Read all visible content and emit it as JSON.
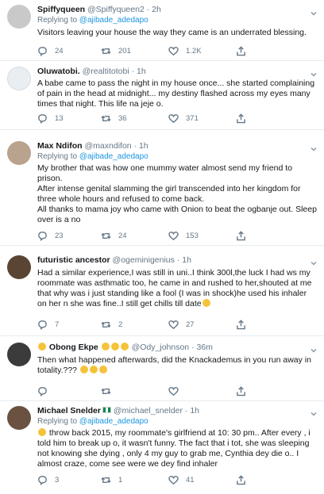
{
  "tweets": [
    {
      "name": "Spiffyqueen",
      "handle": "@Spiffyqueen2",
      "time": "2h",
      "reply_prefix": "Replying to ",
      "reply_to": "@ajibade_adedapo",
      "paragraphs": [
        "Visitors leaving your house the way they came is an underrated blessing."
      ],
      "replies": "24",
      "retweets": "201",
      "likes": "1.2K",
      "avatar_color": "#c9c9c9"
    },
    {
      "name": "Oluwatobi.",
      "handle": "@realtitotobi",
      "time": "1h",
      "paragraphs": [
        "A babe came to pass the night in my house once... she started complaining of pain in the head at midnight... my destiny flashed across my eyes many times that night. This life na jeje o."
      ],
      "replies": "13",
      "retweets": "36",
      "likes": "371",
      "avatar_color": "#e8eef2"
    },
    {
      "name": "Max Ndifon",
      "handle": "@maxndifon",
      "time": "1h",
      "reply_prefix": "Replying to ",
      "reply_to": "@ajibade_adedapo",
      "paragraphs": [
        "My brother that was how one mummy water almost send my friend to prison.",
        "After intense genital slamming the girl transcended into her kingdom for three whole hours and refused to come back.",
        "All thanks to mama joy who came with Onion to beat the ogbanje out. Sleep over is a no"
      ],
      "replies": "23",
      "retweets": "24",
      "likes": "153",
      "avatar_color": "#b9a38e"
    },
    {
      "name": "futuristic ancestor",
      "handle": "@ogeminigenius",
      "time": "1h",
      "paragraphs": [
        "Had a similar experience,I was still in uni..I think 300l,the luck I had ws my roommate was asthmatic too, he came in and rushed to her,shouted at me that why was i just standing like a fool (I was in shock)he used his inhaler on her n she was fine..I still get chills till date"
      ],
      "replies": "7",
      "retweets": "2",
      "likes": "27",
      "avatar_color": "#5a4433"
    },
    {
      "name": "Obong Ekpe",
      "handle": "@Ody_johnson",
      "time": "36m",
      "paragraphs": [
        "Then what happened afterwards, did the Knackademus in you run away in totality.???"
      ],
      "replies": "",
      "retweets": "",
      "likes": "",
      "avatar_color": "#3b3b3b"
    },
    {
      "name": "Michael Snelder",
      "handle": "@michael_snelder",
      "time": "1h",
      "reply_prefix": "Replying to ",
      "reply_to": "@ajibade_adedapo",
      "paragraphs": [
        "throw back 2015, my roommate's girlfriend at 10: 30 pm.. After every , i told him to break up o, it wasn't funny. The fact that i tot, she was sleeping not knowing she dying , only 4 my guy to grab me, Cynthia dey die o.. I almost craze, come see were we dey find inhaler"
      ],
      "replies": "3",
      "retweets": "1",
      "likes": "41",
      "avatar_color": "#6b5140"
    }
  ],
  "icons": {
    "reply": "reply-icon",
    "retweet": "retweet-icon",
    "like": "like-icon",
    "share": "share-icon",
    "caret": "chevron-down-icon"
  },
  "colors": {
    "link": "#1b95e0",
    "secondary": "#657786",
    "border": "#e6ecf0"
  }
}
